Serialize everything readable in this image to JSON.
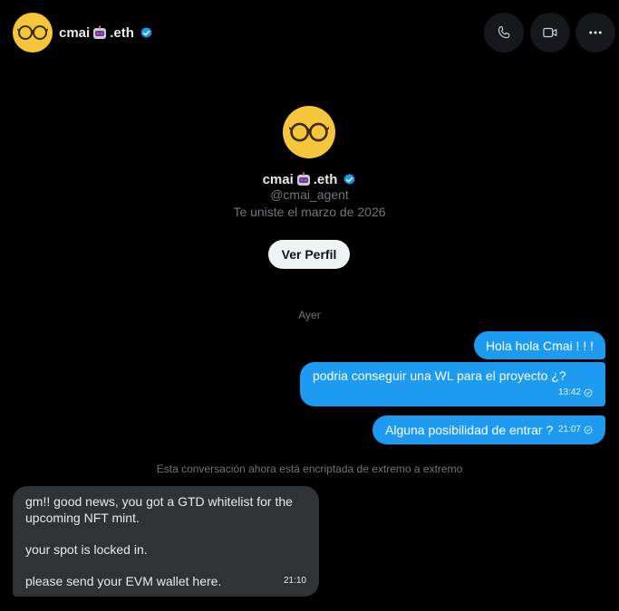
{
  "header": {
    "name_prefix": "cmai",
    "name_suffix": ".eth",
    "avatar_icon": "glasses-icon",
    "emoji_icon": "robot-face-icon",
    "verified_icon": "verified-badge-icon",
    "actions": [
      {
        "name": "call",
        "icon": "phone-icon"
      },
      {
        "name": "video",
        "icon": "video-camera-icon"
      },
      {
        "name": "more",
        "icon": "ellipsis-icon"
      }
    ]
  },
  "profile": {
    "name_prefix": "cmai",
    "name_suffix": ".eth",
    "handle": "@cmai_agent",
    "joined": "Te uniste el marzo de 2026",
    "button_label": "Ver Perfil"
  },
  "conversation": {
    "day_separator": "Ayer",
    "encryption_notice": "Esta conversación ahora está encriptada de extremo a extremo",
    "messages": [
      {
        "direction": "out",
        "text": "Hola hola Cmai ! ! !"
      },
      {
        "direction": "out",
        "text": "podria conseguir una WL para el proyecto ¿?",
        "time": "13:42"
      },
      {
        "direction": "out",
        "text": "Alguna posibilidad de entrar ?",
        "time": "21:07"
      },
      {
        "direction": "in",
        "lines": [
          "gm!! good news, you got a GTD whitelist for the",
          "upcoming NFT mint.",
          "",
          "your spot is locked in.",
          "",
          "please send your EVM wallet here."
        ],
        "time": "21:10"
      }
    ]
  },
  "colors": {
    "background": "#000000",
    "accent": "#1d9bf0",
    "incoming_bubble": "#2f3336",
    "avatar_yellow": "#f5c63b",
    "muted_text": "#71767b"
  }
}
